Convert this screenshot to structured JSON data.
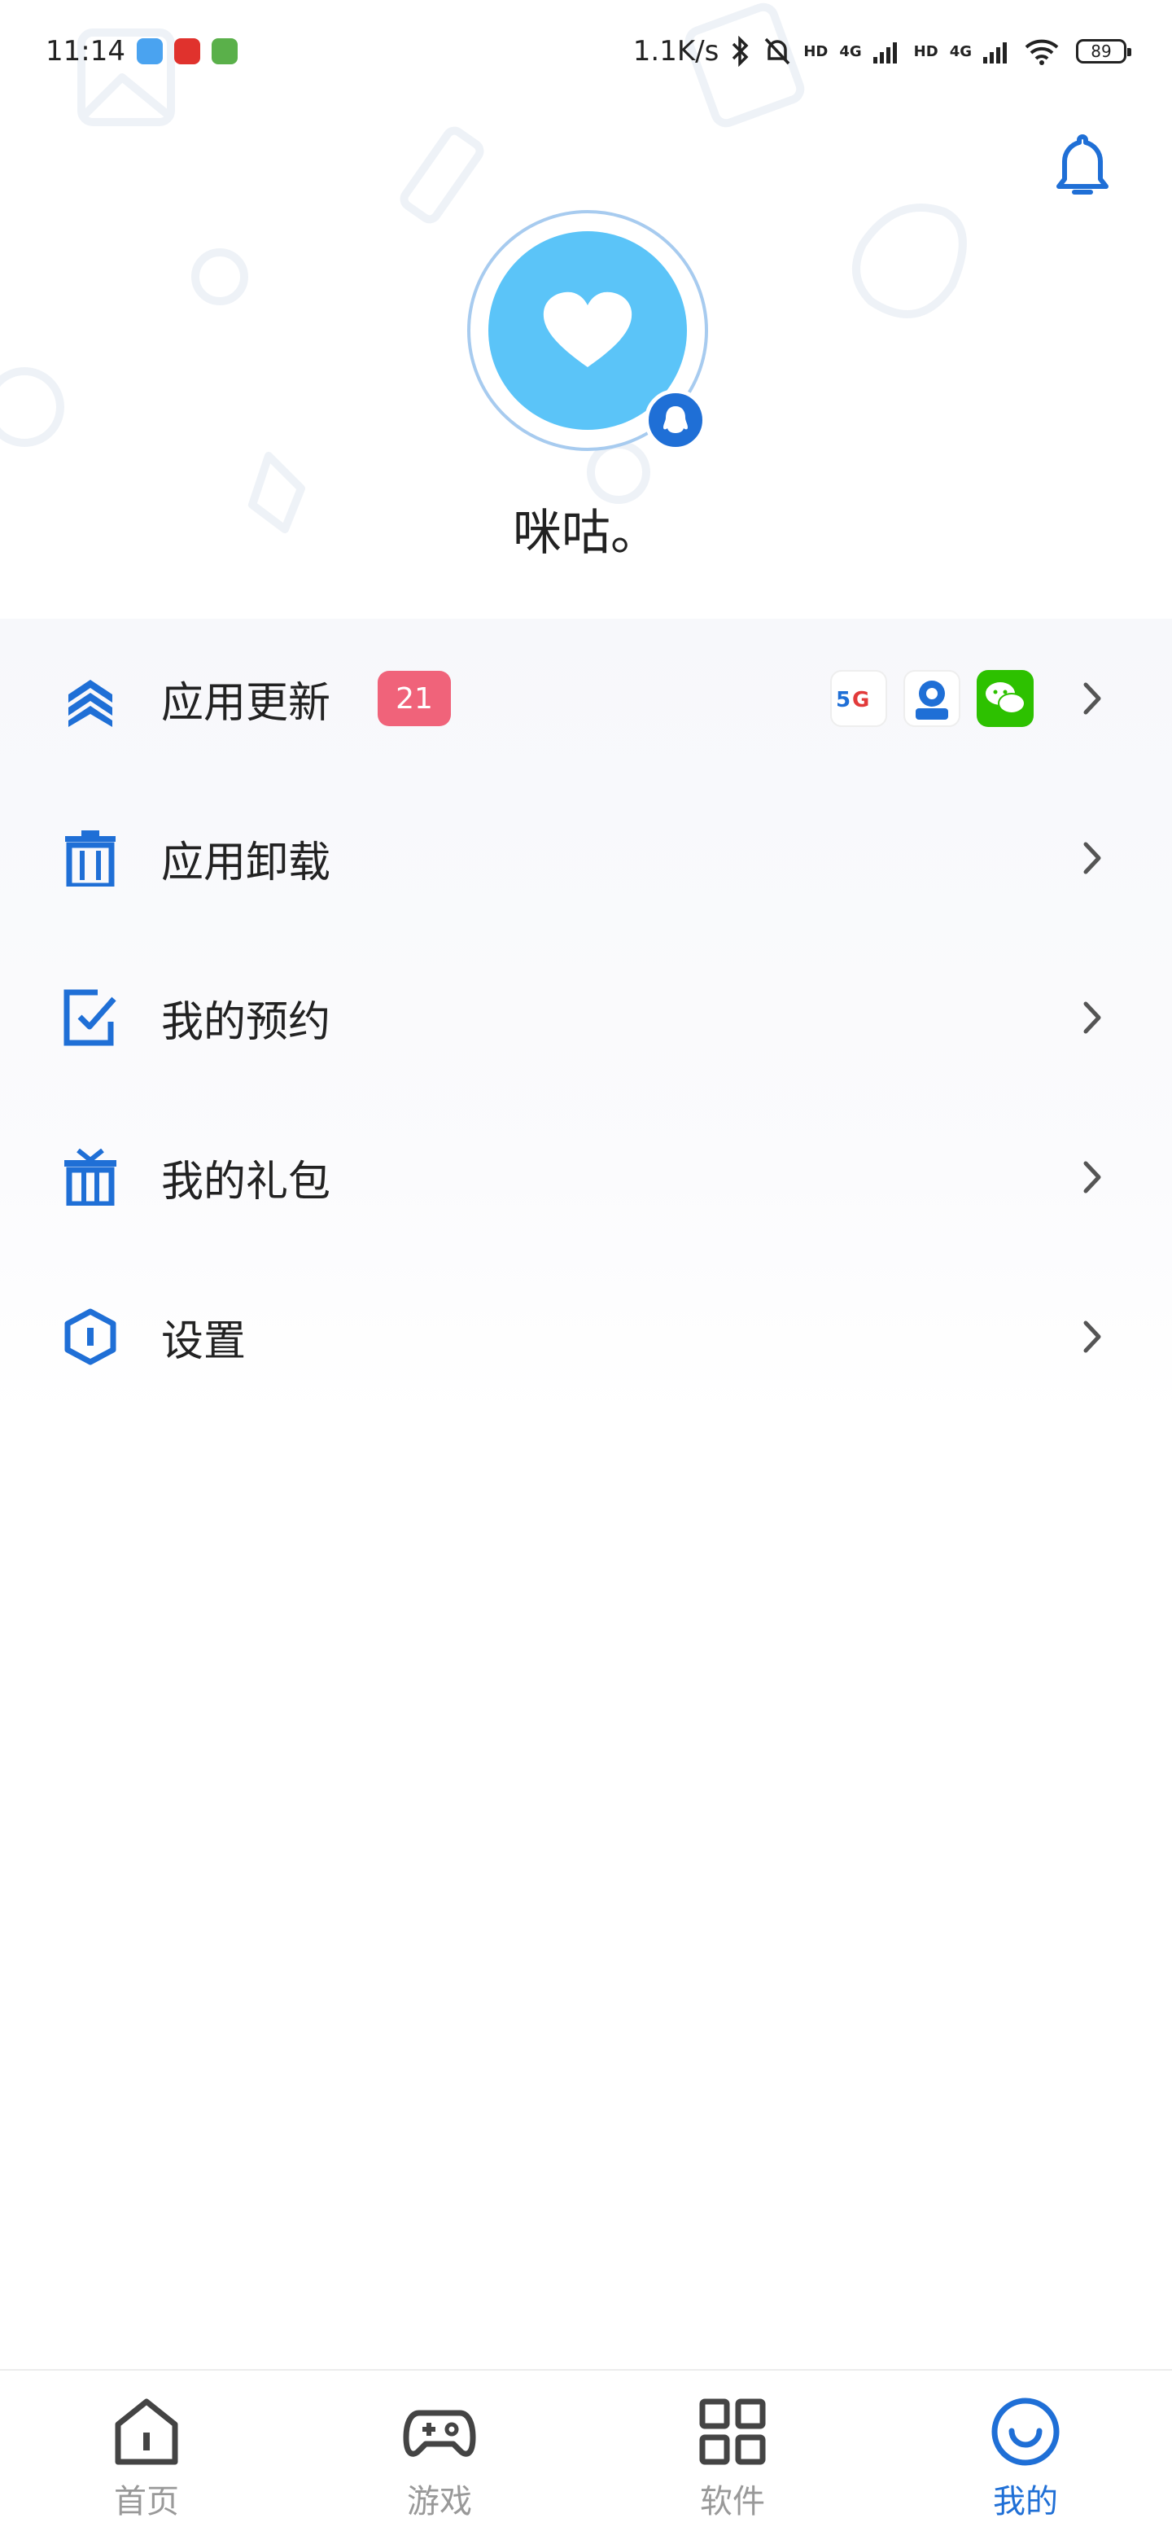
{
  "status_bar": {
    "time": "11:14",
    "net_speed": "1.1K/s",
    "hd1": "HD",
    "net1": "4G",
    "hd2": "HD",
    "net2": "4G",
    "battery": "89",
    "apps": [
      {
        "icon": "weather-app-icon",
        "color": "#4aa3f0"
      },
      {
        "icon": "pinduoduo-app-icon",
        "color": "#e0322d"
      },
      {
        "icon": "android-robot-app-icon",
        "color": "#5ab04a"
      }
    ]
  },
  "profile": {
    "username": "咪咕。",
    "avatar_color": "#5bc4f8",
    "login_icon": "qq-penguin-icon"
  },
  "menu": {
    "items": [
      {
        "label": "应用更新",
        "icon": "update-chevrons-icon",
        "badge": "21"
      },
      {
        "label": "应用卸载",
        "icon": "trash-icon"
      },
      {
        "label": "我的预约",
        "icon": "reservation-check-icon"
      },
      {
        "label": "我的礼包",
        "icon": "gift-icon"
      },
      {
        "label": "设置",
        "icon": "settings-hexagon-icon"
      }
    ],
    "update_apps": [
      {
        "icon": "5g-app-icon"
      },
      {
        "icon": "bank-app-icon"
      },
      {
        "icon": "wechat-app-icon"
      }
    ]
  },
  "nav": {
    "items": [
      {
        "label": "首页",
        "icon": "home-icon",
        "active": false
      },
      {
        "label": "游戏",
        "icon": "gamepad-icon",
        "active": false
      },
      {
        "label": "软件",
        "icon": "apps-grid-icon",
        "active": false
      },
      {
        "label": "我的",
        "icon": "smile-icon",
        "active": true
      }
    ]
  },
  "colors": {
    "accent": "#1f6fd6",
    "badge": "#f0637a",
    "inactive": "#999999"
  }
}
